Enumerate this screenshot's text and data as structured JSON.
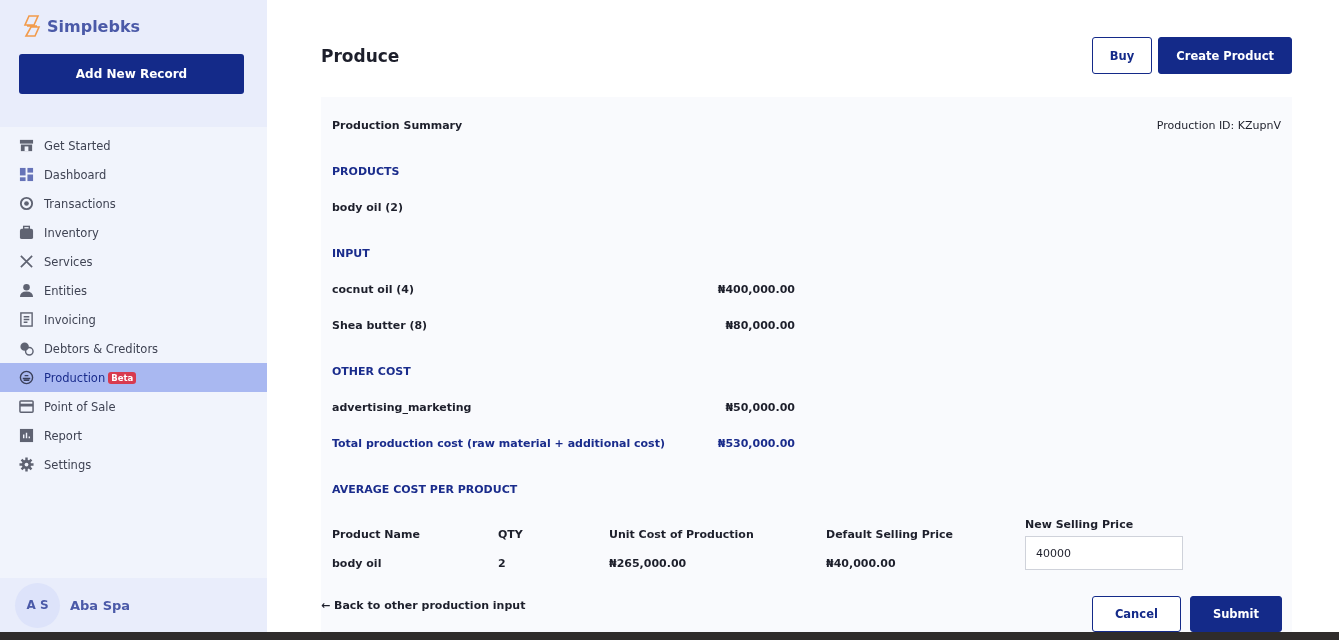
{
  "sidebar": {
    "brand": "Simplebks",
    "add_button": "Add New Record",
    "items": [
      {
        "label": "Get Started",
        "selected": false
      },
      {
        "label": "Dashboard",
        "selected": false
      },
      {
        "label": "Transactions",
        "selected": false
      },
      {
        "label": "Inventory",
        "selected": false
      },
      {
        "label": "Services",
        "selected": false
      },
      {
        "label": "Entities",
        "selected": false
      },
      {
        "label": "Invoicing",
        "selected": false
      },
      {
        "label": "Debtors & Creditors",
        "selected": false
      },
      {
        "label": "Production",
        "selected": true,
        "badge": "Beta"
      },
      {
        "label": "Point of Sale",
        "selected": false
      },
      {
        "label": "Report",
        "selected": false
      },
      {
        "label": "Settings",
        "selected": false
      }
    ],
    "user": {
      "initials": "A S",
      "name": "Aba Spa"
    }
  },
  "header": {
    "title": "Produce",
    "buttons": [
      {
        "label": "Buy",
        "kind": "outline"
      },
      {
        "label": "Create Product",
        "kind": "primary"
      }
    ]
  },
  "summary": {
    "title": "Production Summary",
    "production_id": "Production ID: KZupnV",
    "sections": [
      {
        "heading": "PRODUCTS",
        "rows": [
          {
            "label": "body oil (2)"
          }
        ]
      },
      {
        "heading": "INPUT",
        "rows": [
          {
            "label": "cocnut oil (4)",
            "amount": "₦400,000.00"
          },
          {
            "label": "Shea butter (8)",
            "amount": "₦80,000.00"
          }
        ]
      },
      {
        "heading": "OTHER COST",
        "rows": [
          {
            "label": "advertising_marketing",
            "amount": "₦50,000.00"
          }
        ]
      }
    ],
    "total": {
      "label": "Total production cost (raw material + additional cost)",
      "amount": "₦530,000.00"
    },
    "average_heading": "AVERAGE COST PER PRODUCT",
    "table": {
      "columns": [
        "Product Name",
        "QTY",
        "Unit Cost of Production",
        "Default Selling Price",
        "New Selling Price"
      ],
      "rows": [
        {
          "product": "body oil",
          "qty": "2",
          "unit_cost": "₦265,000.00",
          "default_price": "₦40,000.00",
          "new_price": "40000"
        }
      ]
    }
  },
  "footer": {
    "back_link": "← Back to other production input",
    "buttons": [
      {
        "label": "Cancel",
        "kind": "outline"
      },
      {
        "label": "Submit",
        "kind": "primary"
      }
    ]
  }
}
